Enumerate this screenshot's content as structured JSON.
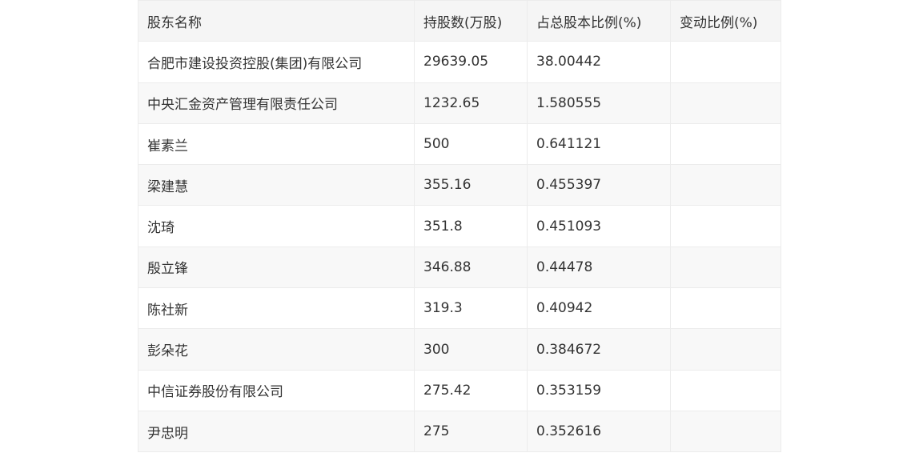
{
  "table": {
    "headers": [
      "股东名称",
      "持股数(万股)",
      "占总股本比例(%)",
      "变动比例(%)"
    ],
    "rows": [
      [
        "合肥市建设投资控股(集团)有限公司",
        "29639.05",
        "38.00442",
        ""
      ],
      [
        "中央汇金资产管理有限责任公司",
        "1232.65",
        "1.580555",
        ""
      ],
      [
        "崔素兰",
        "500",
        "0.641121",
        ""
      ],
      [
        "梁建慧",
        "355.16",
        "0.455397",
        ""
      ],
      [
        "沈琦",
        "351.8",
        "0.451093",
        ""
      ],
      [
        "殷立锋",
        "346.88",
        "0.44478",
        ""
      ],
      [
        "陈社新",
        "319.3",
        "0.40942",
        ""
      ],
      [
        "彭朵花",
        "300",
        "0.384672",
        ""
      ],
      [
        "中信证券股份有限公司",
        "275.42",
        "0.353159",
        ""
      ],
      [
        "尹忠明",
        "275",
        "0.352616",
        ""
      ]
    ]
  }
}
